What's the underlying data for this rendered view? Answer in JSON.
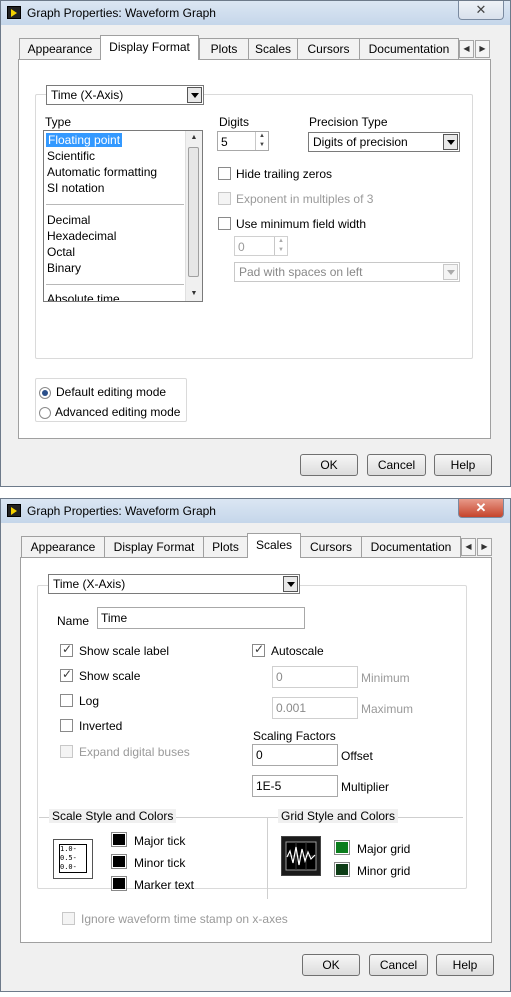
{
  "win1": {
    "title": "Graph Properties: Waveform Graph",
    "close": "✕",
    "tabs": [
      "Appearance",
      "Display Format",
      "Plots",
      "Scales",
      "Cursors",
      "Documentation"
    ],
    "axis_select": "Time (X-Axis)",
    "type_label": "Type",
    "type_items": [
      "Floating point",
      "Scientific",
      "Automatic formatting",
      "SI notation",
      "Decimal",
      "Hexadecimal",
      "Octal",
      "Binary",
      "Absolute time"
    ],
    "digits_label": "Digits",
    "digits_value": "5",
    "precision_label": "Precision Type",
    "precision_value": "Digits of precision",
    "hide_trailing": "Hide trailing zeros",
    "exponent_mult": "Exponent in multiples of 3",
    "min_width": "Use minimum field width",
    "min_width_value": "0",
    "pad_value": "Pad with spaces on left",
    "default_mode": "Default editing mode",
    "advanced_mode": "Advanced editing mode",
    "ok": "OK",
    "cancel": "Cancel",
    "help": "Help"
  },
  "win2": {
    "title": "Graph Properties: Waveform Graph",
    "close": "✕",
    "tabs": [
      "Appearance",
      "Display Format",
      "Plots",
      "Scales",
      "Cursors",
      "Documentation"
    ],
    "axis_select": "Time (X-Axis)",
    "name_label": "Name",
    "name_value": "Time",
    "show_scale_label": "Show scale label",
    "show_scale": "Show scale",
    "log": "Log",
    "inverted": "Inverted",
    "expand_buses": "Expand digital buses",
    "autoscale": "Autoscale",
    "minimum_value": "0",
    "minimum_label": "Minimum",
    "maximum_value": "0.001",
    "maximum_label": "Maximum",
    "scaling_factors": "Scaling Factors",
    "offset_value": "0",
    "offset_label": "Offset",
    "multiplier_value": "1E-5",
    "multiplier_label": "Multiplier",
    "scale_style_title": "Scale Style and Colors",
    "scale_preview_ticks": [
      "1.0-",
      "0.5-",
      "0.0-"
    ],
    "major_tick": "Major tick",
    "minor_tick": "Minor tick",
    "marker_text": "Marker text",
    "grid_style_title": "Grid Style and Colors",
    "major_grid": "Major grid",
    "minor_grid": "Minor grid",
    "ignore_timestamp": "Ignore waveform time stamp on x-axes",
    "ok": "OK",
    "cancel": "Cancel",
    "help": "Help",
    "colors": {
      "major_grid": "#0a7d1c",
      "minor_grid": "#0d3d16"
    }
  }
}
